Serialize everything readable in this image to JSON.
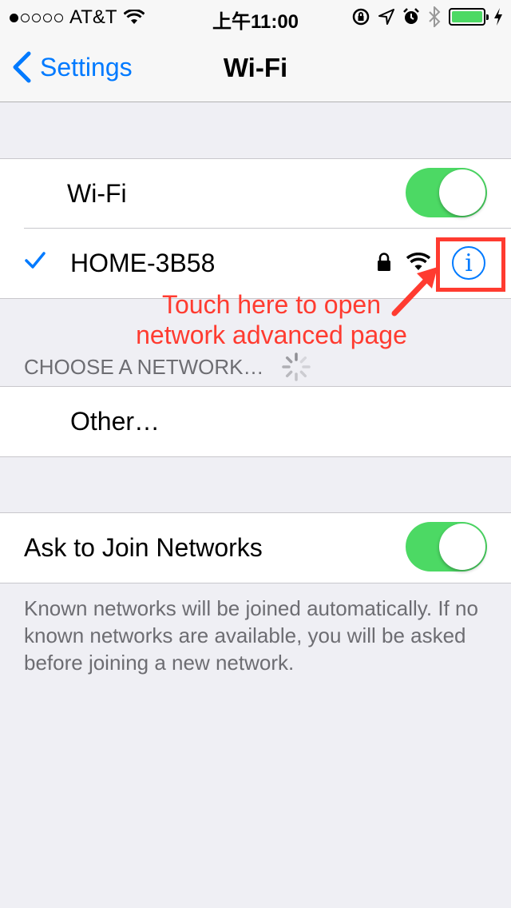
{
  "status_bar": {
    "signal_bars_filled": 1,
    "signal_bars_total": 5,
    "carrier": "AT&T",
    "time": "上午11:00",
    "icons": [
      "wifi-icon",
      "rotation-lock-icon",
      "location-icon",
      "alarm-icon",
      "bluetooth-icon",
      "battery-icon",
      "charging-icon"
    ],
    "battery_level": 1.0
  },
  "nav": {
    "back_label": "Settings",
    "title": "Wi-Fi"
  },
  "wifi_group": {
    "wifi_label": "Wi-Fi",
    "wifi_on": true,
    "connected_network": "HOME-3B58",
    "connected_secured": true
  },
  "annotation": {
    "line1": "Touch here to open",
    "line2": "network advanced page"
  },
  "choose_section": {
    "header": "CHOOSE A NETWORK…",
    "other_label": "Other…"
  },
  "ask_group": {
    "label": "Ask to Join Networks",
    "on": true,
    "description": "Known networks will be joined automatically. If no known networks are available, you will be asked before joining a new network."
  },
  "colors": {
    "accent": "#007aff",
    "toggle_on": "#4cd964",
    "annotation": "#ff3b30",
    "background": "#efeff4"
  }
}
